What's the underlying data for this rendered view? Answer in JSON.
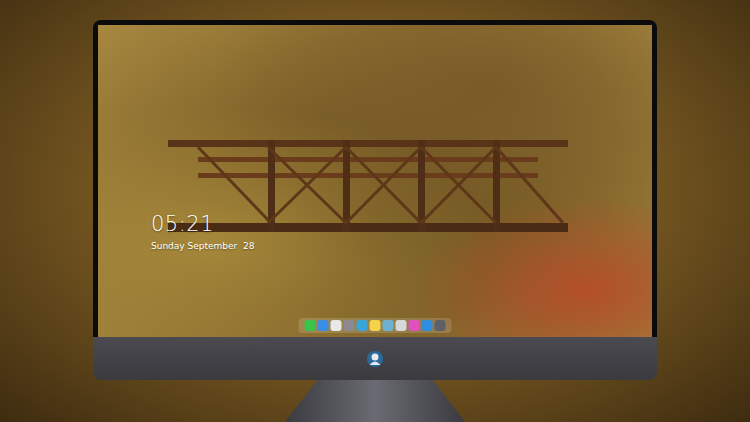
{
  "lock_screen": {
    "time": "05:21",
    "date": "Sunday September  28"
  }
}
